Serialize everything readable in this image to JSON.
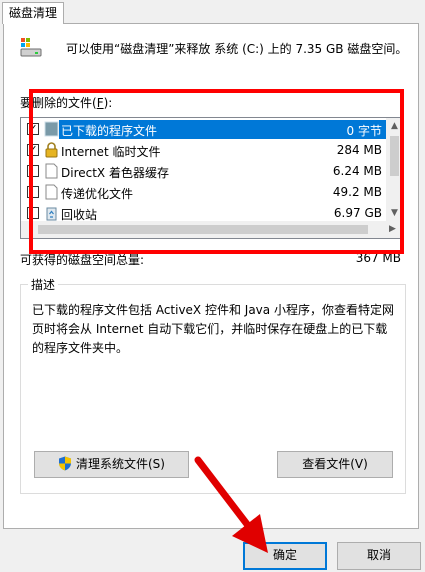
{
  "tab": {
    "label": "磁盘清理"
  },
  "header": {
    "text": "可以使用“磁盘清理”来释放 系统 (C:) 上的 7.35 GB 磁盘空间。"
  },
  "files_section": {
    "label": "要删除的文件(",
    "access_key": "F",
    "label_end": "):"
  },
  "files": [
    {
      "checked": true,
      "icon": "download-folder-icon",
      "name": "已下载的程序文件",
      "size": "0 字节",
      "selected": true
    },
    {
      "checked": true,
      "icon": "lock-icon",
      "name": "Internet 临时文件",
      "size": "284 MB",
      "selected": false
    },
    {
      "checked": false,
      "icon": "file-icon",
      "name": "DirectX 着色器缓存",
      "size": "6.24 MB",
      "selected": false
    },
    {
      "checked": false,
      "icon": "file-icon",
      "name": "传递优化文件",
      "size": "49.2 MB",
      "selected": false
    },
    {
      "checked": false,
      "icon": "recycle-bin-icon",
      "name": "回收站",
      "size": "6.97 GB",
      "selected": false
    }
  ],
  "gain": {
    "label": "可获得的磁盘空间总量:",
    "value": "367 MB"
  },
  "description": {
    "title": "描述",
    "text": "已下载的程序文件包括 ActiveX 控件和 Java 小程序，你查看特定网页时将会从 Internet 自动下载它们，并临时保存在硬盘上的已下载的程序文件夹中。"
  },
  "buttons": {
    "clean_system": "清理系统文件(S)",
    "view_files": "查看文件(V)",
    "ok": "确定",
    "cancel": "取消"
  },
  "colors": {
    "selection": "#0078d7",
    "annotation": "#ff0000"
  }
}
